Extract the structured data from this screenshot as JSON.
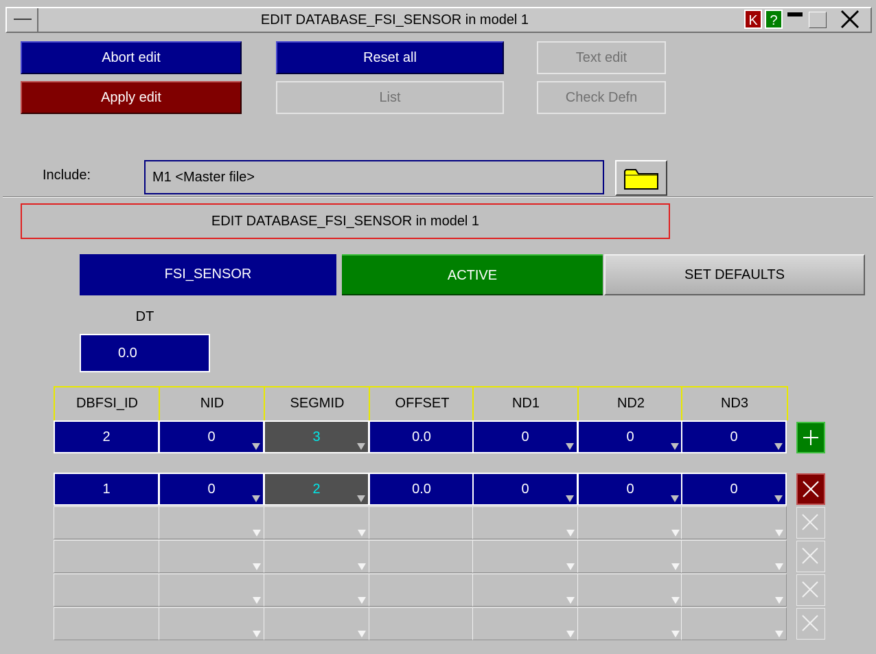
{
  "window": {
    "title": "EDIT DATABASE_FSI_SENSOR in model 1",
    "k_label": "K",
    "help_label": "?",
    "close_label": "X"
  },
  "toolbar": {
    "abort": "Abort edit",
    "apply": "Apply edit",
    "reset": "Reset all",
    "list": "List",
    "text_edit": "Text edit",
    "check_defn": "Check Defn"
  },
  "include": {
    "label": "Include:",
    "value": "M1  <Master file>"
  },
  "header_box": "EDIT DATABASE_FSI_SENSOR in model 1",
  "keyword_bar": {
    "keyword": "FSI_SENSOR",
    "status": "ACTIVE",
    "set_defaults": "SET DEFAULTS"
  },
  "dt": {
    "label": "DT",
    "value": "0.0"
  },
  "table": {
    "columns": [
      "DBFSI_ID",
      "NID",
      "SEGMID",
      "OFFSET",
      "ND1",
      "ND2",
      "ND3"
    ],
    "new_row": [
      "2",
      "0",
      "3",
      "0.0",
      "0",
      "0",
      "0"
    ],
    "rows": [
      [
        "1",
        "0",
        "2",
        "0.0",
        "0",
        "0",
        "0"
      ],
      [
        "",
        "",
        "",
        "",
        "",
        "",
        ""
      ],
      [
        "",
        "",
        "",
        "",
        "",
        "",
        ""
      ],
      [
        "",
        "",
        "",
        "",
        "",
        "",
        ""
      ],
      [
        "",
        "",
        "",
        "",
        "",
        "",
        ""
      ]
    ]
  },
  "colors": {
    "panel": "#c0c0c0",
    "field_blue": "#00008c",
    "apply_red": "#800000",
    "active_green": "#008000",
    "header_yellow": "#e8e800",
    "header_box_red": "#e02020",
    "segmid_cyan": "#00e8e8"
  }
}
